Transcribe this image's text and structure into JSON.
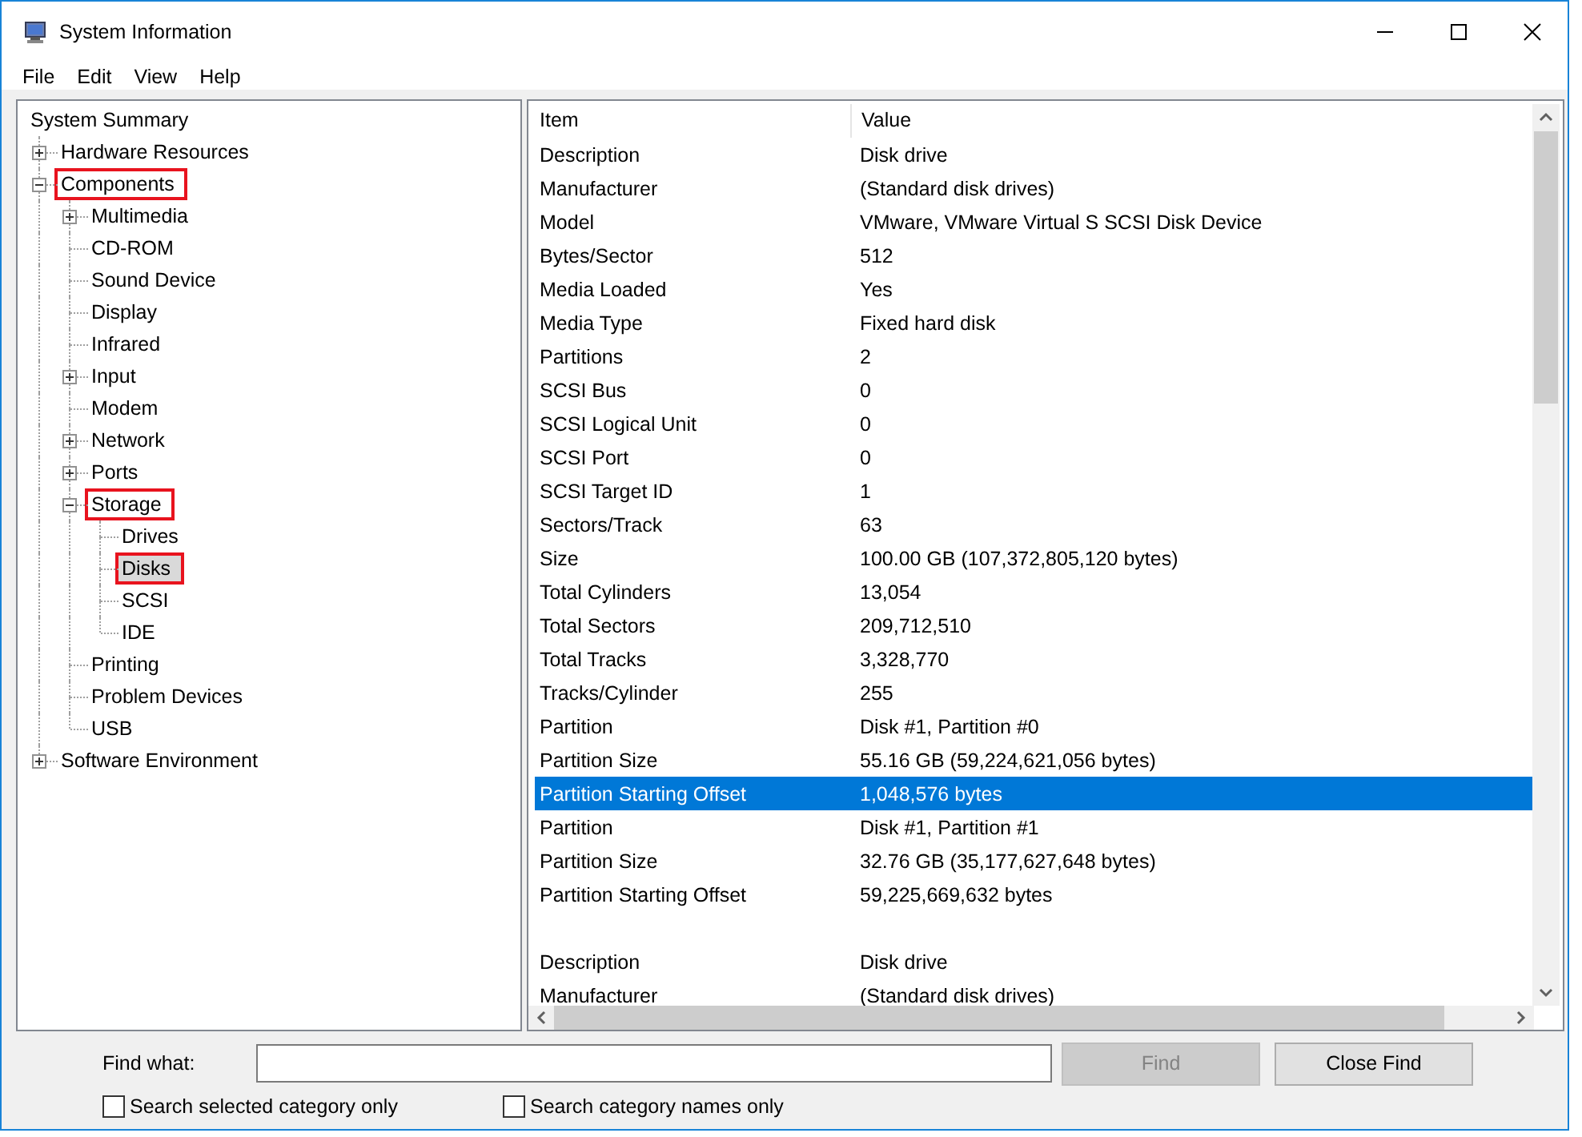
{
  "window": {
    "title": "System Information"
  },
  "menu": [
    "File",
    "Edit",
    "View",
    "Help"
  ],
  "tree": {
    "label": "System Summary",
    "selected": false,
    "marked": false,
    "children": [
      {
        "label": "Hardware Resources",
        "selected": false,
        "marked": false,
        "expanded": false
      },
      {
        "label": "Components",
        "selected": false,
        "marked": true,
        "expanded": true,
        "children": [
          {
            "label": "Multimedia",
            "selected": false,
            "marked": false,
            "expanded": false
          },
          {
            "label": "CD-ROM",
            "selected": false,
            "marked": false
          },
          {
            "label": "Sound Device",
            "selected": false,
            "marked": false
          },
          {
            "label": "Display",
            "selected": false,
            "marked": false
          },
          {
            "label": "Infrared",
            "selected": false,
            "marked": false
          },
          {
            "label": "Input",
            "selected": false,
            "marked": false,
            "expanded": false
          },
          {
            "label": "Modem",
            "selected": false,
            "marked": false
          },
          {
            "label": "Network",
            "selected": false,
            "marked": false,
            "expanded": false
          },
          {
            "label": "Ports",
            "selected": false,
            "marked": false,
            "expanded": false
          },
          {
            "label": "Storage",
            "selected": false,
            "marked": true,
            "expanded": true,
            "children": [
              {
                "label": "Drives",
                "selected": false,
                "marked": false
              },
              {
                "label": "Disks",
                "selected": true,
                "marked": true
              },
              {
                "label": "SCSI",
                "selected": false,
                "marked": false
              },
              {
                "label": "IDE",
                "selected": false,
                "marked": false
              }
            ]
          },
          {
            "label": "Printing",
            "selected": false,
            "marked": false
          },
          {
            "label": "Problem Devices",
            "selected": false,
            "marked": false
          },
          {
            "label": "USB",
            "selected": false,
            "marked": false
          }
        ]
      },
      {
        "label": "Software Environment",
        "selected": false,
        "marked": false,
        "expanded": false
      }
    ]
  },
  "table": {
    "columns": [
      "Item",
      "Value"
    ],
    "rows": [
      {
        "item": "Description",
        "value": "Disk drive",
        "selected": false
      },
      {
        "item": "Manufacturer",
        "value": "(Standard disk drives)",
        "selected": false
      },
      {
        "item": "Model",
        "value": "VMware, VMware Virtual S SCSI Disk Device",
        "selected": false
      },
      {
        "item": "Bytes/Sector",
        "value": "512",
        "selected": false
      },
      {
        "item": "Media Loaded",
        "value": "Yes",
        "selected": false
      },
      {
        "item": "Media Type",
        "value": "Fixed hard disk",
        "selected": false
      },
      {
        "item": "Partitions",
        "value": "2",
        "selected": false
      },
      {
        "item": "SCSI Bus",
        "value": "0",
        "selected": false
      },
      {
        "item": "SCSI Logical Unit",
        "value": "0",
        "selected": false
      },
      {
        "item": "SCSI Port",
        "value": "0",
        "selected": false
      },
      {
        "item": "SCSI Target ID",
        "value": "1",
        "selected": false
      },
      {
        "item": "Sectors/Track",
        "value": "63",
        "selected": false
      },
      {
        "item": "Size",
        "value": "100.00 GB (107,372,805,120 bytes)",
        "selected": false
      },
      {
        "item": "Total Cylinders",
        "value": "13,054",
        "selected": false
      },
      {
        "item": "Total Sectors",
        "value": "209,712,510",
        "selected": false
      },
      {
        "item": "Total Tracks",
        "value": "3,328,770",
        "selected": false
      },
      {
        "item": "Tracks/Cylinder",
        "value": "255",
        "selected": false
      },
      {
        "item": "Partition",
        "value": "Disk #1, Partition #0",
        "selected": false
      },
      {
        "item": "Partition Size",
        "value": "55.16 GB (59,224,621,056 bytes)",
        "selected": false
      },
      {
        "item": "Partition Starting Offset",
        "value": "1,048,576 bytes",
        "selected": true
      },
      {
        "item": "Partition",
        "value": "Disk #1, Partition #1",
        "selected": false
      },
      {
        "item": "Partition Size",
        "value": "32.76 GB (35,177,627,648 bytes)",
        "selected": false
      },
      {
        "item": "Partition Starting Offset",
        "value": "59,225,669,632 bytes",
        "selected": false
      },
      {
        "item": "Description",
        "value": "Disk drive",
        "selected": false,
        "new_group": true
      },
      {
        "item": "Manufacturer",
        "value": "(Standard disk drives)",
        "selected": false
      }
    ]
  },
  "find": {
    "label": "Find what:",
    "buttons": [
      {
        "label": "Find",
        "disabled": true
      },
      {
        "label": "Close Find",
        "disabled": false
      }
    ],
    "options": [
      {
        "label": "Search selected category only",
        "checked": false
      },
      {
        "label": "Search category names only",
        "checked": false
      }
    ]
  }
}
